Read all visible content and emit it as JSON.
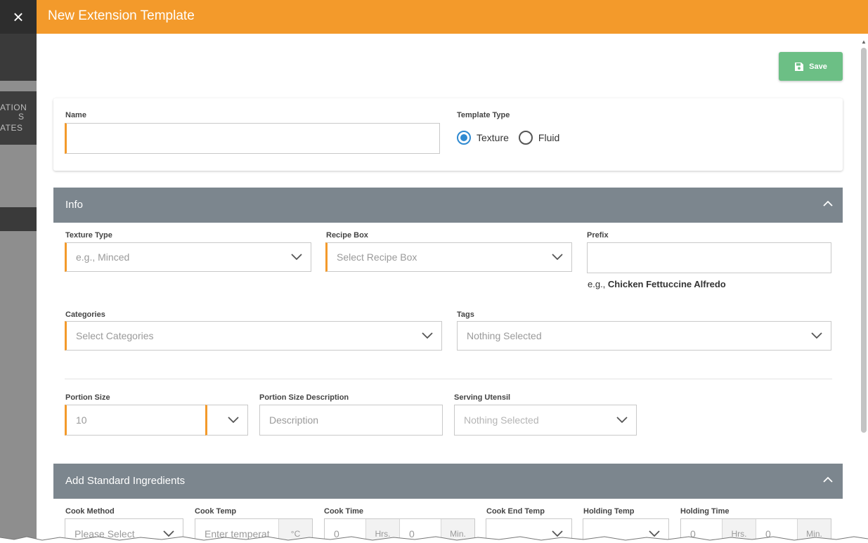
{
  "app": {
    "close_icon": "×",
    "bg_fragments": [
      "ATION",
      "S",
      "ATES"
    ]
  },
  "modal": {
    "title": "New Extension Template",
    "save_label": "Save"
  },
  "general": {
    "name_label": "Name",
    "name_value": "",
    "template_type_label": "Template Type",
    "template_types": [
      {
        "label": "Texture",
        "selected": true
      },
      {
        "label": "Fluid",
        "selected": false
      }
    ]
  },
  "info": {
    "title": "Info",
    "texture_type": {
      "label": "Texture Type",
      "placeholder": "e.g., Minced"
    },
    "recipe_box": {
      "label": "Recipe Box",
      "placeholder": "Select Recipe Box"
    },
    "prefix": {
      "label": "Prefix",
      "value": "",
      "hint_prefix": "e.g., ",
      "hint_example": "Chicken Fettuccine Alfredo"
    },
    "categories": {
      "label": "Categories",
      "placeholder": "Select Categories"
    },
    "tags": {
      "label": "Tags",
      "placeholder": "Nothing Selected"
    },
    "portion_size": {
      "label": "Portion Size",
      "value": "10"
    },
    "portion_size_description": {
      "label": "Portion Size Description",
      "placeholder": "Description"
    },
    "serving_utensil": {
      "label": "Serving Utensil",
      "placeholder": "Nothing Selected"
    }
  },
  "ingredients": {
    "title": "Add Standard Ingredients",
    "cook_method": {
      "label": "Cook Method",
      "placeholder": "Please Select"
    },
    "cook_temp": {
      "label": "Cook Temp",
      "placeholder": "Enter temperat",
      "unit": "°C"
    },
    "cook_time": {
      "label": "Cook Time",
      "hours_value": "0",
      "hours_unit": "Hrs.",
      "minutes_value": "0",
      "minutes_unit": "Min."
    },
    "cook_end_temp": {
      "label": "Cook End Temp"
    },
    "holding_temp": {
      "label": "Holding Temp"
    },
    "holding_time": {
      "label": "Holding Time",
      "hours_value": "0",
      "hours_unit": "Hrs.",
      "minutes_value": "0",
      "minutes_unit": "Min."
    }
  },
  "colors": {
    "header": "#f39a2b",
    "required_marker": "#f39a2b",
    "save_button": "#6cbf85",
    "section_header": "#7c868e",
    "radio_selected": "#2f8ad1"
  },
  "icons": {
    "close": "close-icon",
    "save": "floppy-disk-icon",
    "chevron": "chevron-down-icon",
    "collapse": "chevron-up-icon"
  }
}
